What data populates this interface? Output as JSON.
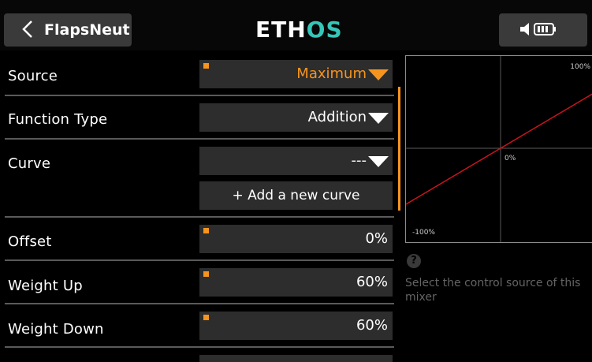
{
  "header": {
    "title": "FlapsNeut",
    "logo": "ETHOS",
    "icons": [
      "back-chevron-icon",
      "speaker-icon",
      "battery-icon"
    ],
    "logo_colors": {
      "eth": "#ffffff",
      "os": "#34c6b9"
    }
  },
  "rows": {
    "source": {
      "label": "Source",
      "value": "Maximum"
    },
    "function_type": {
      "label": "Function Type",
      "value": "Addition"
    },
    "curve": {
      "label": "Curve",
      "value": "---",
      "add_button": "+ Add a new curve"
    },
    "offset": {
      "label": "Offset",
      "value": "0%"
    },
    "weight_up": {
      "label": "Weight Up",
      "value": "60%"
    },
    "weight_down": {
      "label": "Weight Down",
      "value": "60%"
    }
  },
  "graph": {
    "top_label": "100%",
    "center_label": "0%",
    "bottom_label": "-100%"
  },
  "help": {
    "icon": "question-icon",
    "text": "Select the control source of this mixer"
  },
  "colors": {
    "accent": "#f7941d",
    "field_bg": "#2d2d2d",
    "curve_line": "#c8141e"
  }
}
